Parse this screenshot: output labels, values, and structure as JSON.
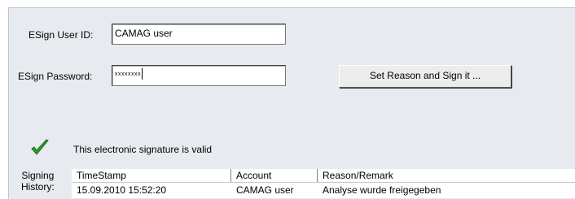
{
  "form": {
    "user_id_label": "ESign User ID:",
    "user_id_value": "CAMAG user",
    "password_label": "ESign Password:",
    "password_value": "xxxxxxxx",
    "sign_button_label": "Set Reason and Sign it ..."
  },
  "status": {
    "icon": "checkmark-icon",
    "icon_color": "#2e9a2e",
    "text": "This electronic signature is valid"
  },
  "history": {
    "label_line1": "Signing",
    "label_line2": "History:",
    "columns": [
      "TimeStamp",
      "Account",
      "Reason/Remark"
    ],
    "rows": [
      [
        "15.09.2010 15:52:20",
        "CAMAG user",
        "Analyse wurde freigegeben"
      ]
    ]
  }
}
